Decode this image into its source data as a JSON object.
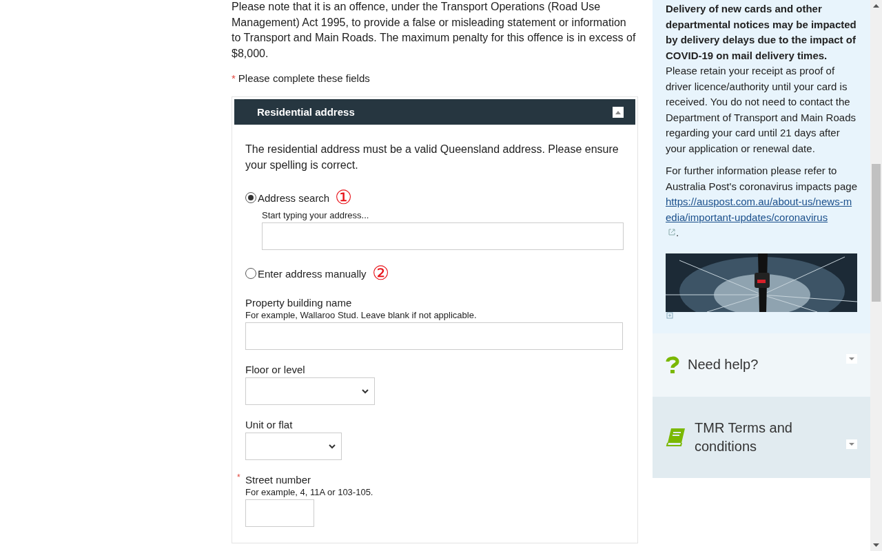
{
  "notice": "Please note that it is an offence, under the Transport Operations (Road Use Management) Act 1995, to provide a false or misleading statement or information to Transport and Main Roads. The maximum penalty for this offence is in excess of $8,000.",
  "required_note": {
    "mark": "*",
    "text": "Please complete these fields"
  },
  "panel": {
    "title": "Residential address",
    "expanded": true,
    "intro": "The residential address must be a valid Queensland address. Please ensure your spelling is correct.",
    "address_options": [
      {
        "label": "Address search",
        "selected": true,
        "marker": "①",
        "field_label": "Start typing your address..."
      },
      {
        "label": "Enter address manually",
        "selected": false,
        "marker": "②"
      }
    ],
    "fields": [
      {
        "kind": "wide-text",
        "label": "Property building name",
        "hint": "For example, Wallaroo Stud. Leave blank if not applicable.",
        "required": false
      },
      {
        "kind": "select",
        "label": "Floor or level",
        "required": false
      },
      {
        "kind": "small-select",
        "label": "Unit or flat",
        "required": false
      },
      {
        "kind": "small-text",
        "label": "Street number",
        "hint": "For example, 4, 11A or 103-105.",
        "required": true,
        "required_mark": "*"
      }
    ]
  },
  "sidebar": {
    "notice": "**Delivery of new cards and other departmental notices may be impacted by delivery delays due to the impact of COVID-19 on mail delivery times.** Please retain your receipt as proof of driver licence/authority until your card is received. You do not need to contact the Department of Transport and Main Roads regarding your card until 21 days after your application or renewal date.",
    "info_text": "For further information please refer to Australia Post's coronavirus impacts page",
    "link": "https://auspost.com.au/about-us/news-media/important-updates/coronavirus",
    "info_end": ".",
    "accordions": [
      {
        "kind": "help",
        "label": "Need help?",
        "expanded": false
      },
      {
        "kind": "book",
        "label": "TMR Terms and conditions",
        "expanded": false
      }
    ]
  }
}
